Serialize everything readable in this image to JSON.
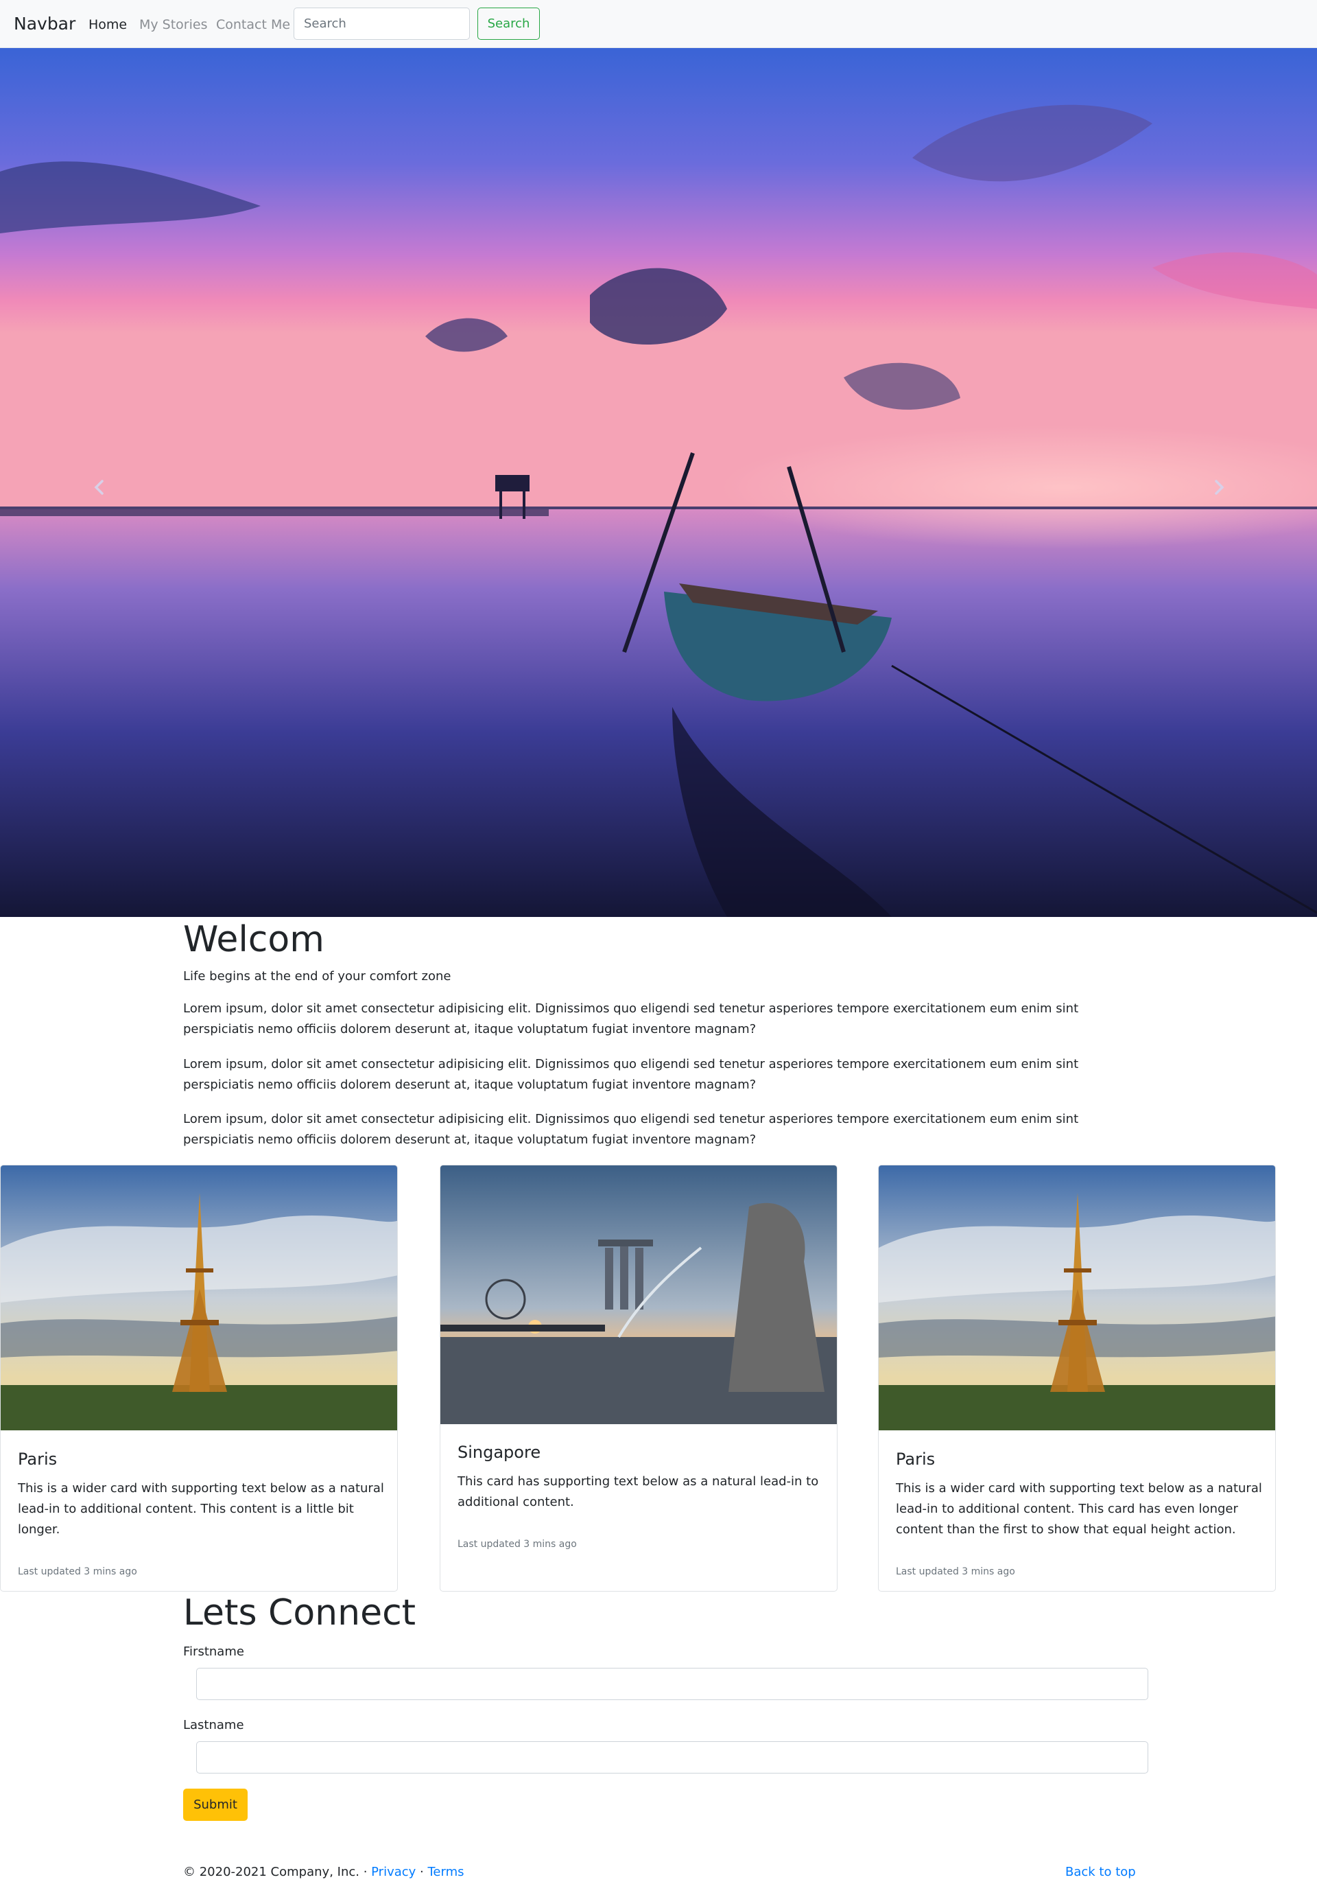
{
  "navbar": {
    "brand": "Navbar",
    "links": [
      {
        "label": "Home",
        "active": true
      },
      {
        "label": "My Stories",
        "active": false
      },
      {
        "label": "Contact Me",
        "active": false
      }
    ],
    "search_placeholder": "Search",
    "search_button": "Search"
  },
  "hero": {
    "prev_icon": "chevron-left-icon",
    "next_icon": "chevron-right-icon"
  },
  "intro": {
    "title": "Welcom",
    "tagline": "Life begins at the end of your comfort zone",
    "paragraphs": [
      "Lorem ipsum, dolor sit amet consectetur adipisicing elit. Dignissimos quo eligendi sed tenetur asperiores tempore exercitationem eum enim sint perspiciatis nemo officiis dolorem deserunt at, itaque voluptatum fugiat inventore magnam?",
      "Lorem ipsum, dolor sit amet consectetur adipisicing elit. Dignissimos quo eligendi sed tenetur asperiores tempore exercitationem eum enim sint perspiciatis nemo officiis dolorem deserunt at, itaque voluptatum fugiat inventore magnam?",
      "Lorem ipsum, dolor sit amet consectetur adipisicing elit. Dignissimos quo eligendi sed tenetur asperiores tempore exercitationem eum enim sint perspiciatis nemo officiis dolorem deserunt at, itaque voluptatum fugiat inventore magnam?"
    ]
  },
  "cards": [
    {
      "title": "Paris",
      "text": "This is a wider card with supporting text below as a natural lead-in to additional content. This content is a little bit longer.",
      "meta": "Last updated 3 mins ago"
    },
    {
      "title": "Singapore",
      "text": "This card has supporting text below as a natural lead-in to additional content.",
      "meta": "Last updated 3 mins ago"
    },
    {
      "title": "Paris",
      "text": "This is a wider card with supporting text below as a natural lead-in to additional content. This card has even longer content than the first to show that equal height action.",
      "meta": "Last updated 3 mins ago"
    }
  ],
  "connect": {
    "title": "Lets Connect",
    "firstname_label": "Firstname",
    "lastname_label": "Lastname",
    "firstname_value": "",
    "lastname_value": "",
    "submit_label": "Submit"
  },
  "footer": {
    "copyright": "© 2020-2021 Company, Inc. · ",
    "privacy": "Privacy",
    "separator": " · ",
    "terms": "Terms",
    "back_to_top": "Back to top"
  },
  "colors": {
    "success": "#28a745",
    "warning": "#ffc107",
    "link": "#007bff"
  }
}
